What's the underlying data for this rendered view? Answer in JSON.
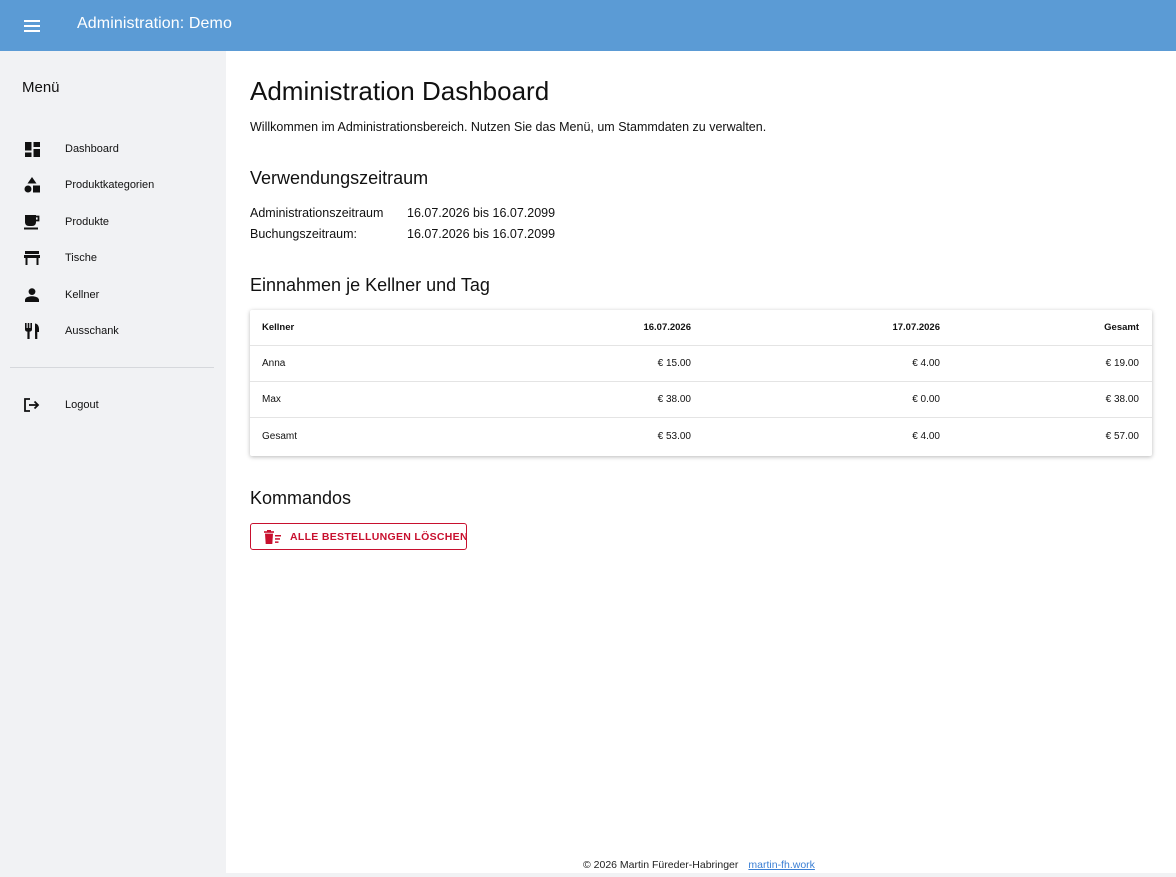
{
  "header": {
    "menu_icon": "hamburger-menu-icon",
    "title": "Administration: Demo",
    "background": "#5b9bd5"
  },
  "sidebar": {
    "heading": "Menü",
    "items": [
      {
        "label": "Dashboard",
        "icon": "dashboard-icon"
      },
      {
        "label": "Produktkategorien",
        "icon": "category-shapes-icon"
      },
      {
        "label": "Produkte",
        "icon": "coffee-cup-icon"
      },
      {
        "label": "Tische",
        "icon": "table-icon"
      },
      {
        "label": "Kellner",
        "icon": "person-icon"
      },
      {
        "label": "Ausschank",
        "icon": "fork-knife-icon"
      }
    ],
    "logout": {
      "label": "Logout",
      "icon": "logout-icon"
    }
  },
  "main": {
    "title": "Administration Dashboard",
    "intro": "Willkommen im Administrationsbereich. Nutzen Sie das Menü, um Stammdaten zu verwalten.",
    "period": {
      "title": "Verwendungszeitraum",
      "rows": [
        {
          "label": "Administrationszeitraum",
          "value": "16.07.2026 bis 16.07.2099"
        },
        {
          "label": "Buchungszeitraum:",
          "value": "16.07.2026 bis 16.07.2099"
        }
      ]
    },
    "revenue": {
      "title": "Einnahmen je Kellner und Tag",
      "headers": [
        "Kellner",
        "16.07.2026",
        "17.07.2026",
        "Gesamt"
      ],
      "rows": [
        [
          "Anna",
          "€ 15.00",
          "€ 4.00",
          "€ 19.00"
        ],
        [
          "Max",
          "€ 38.00",
          "€ 0.00",
          "€ 38.00"
        ],
        [
          "Gesamt",
          "€ 53.00",
          "€ 4.00",
          "€ 57.00"
        ]
      ]
    },
    "commands": {
      "title": "Kommandos",
      "delete_all_label": "ALLE BESTELLUNGEN LÖSCHEN",
      "delete_icon": "delete-sweep-icon",
      "danger_color": "#c8102e"
    }
  },
  "footer": {
    "copyright": "© 2026 Martin Füreder-Habringer",
    "link": "martin-fh.work"
  }
}
